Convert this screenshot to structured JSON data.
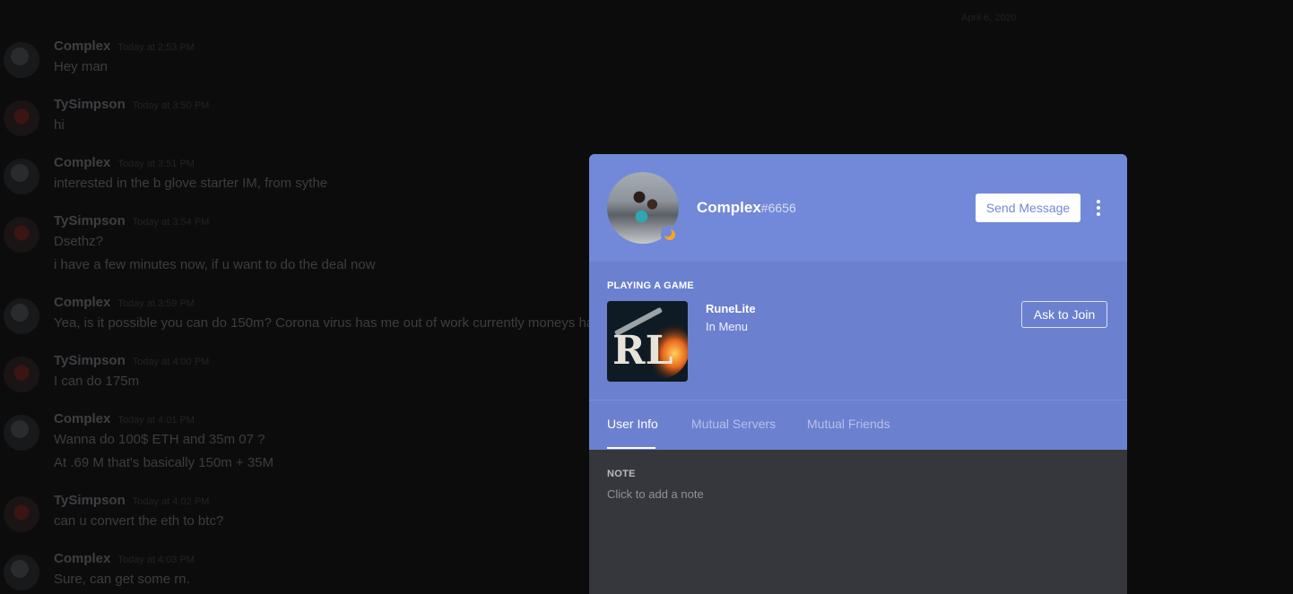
{
  "chat": {
    "date_divider": "April 6, 2020",
    "messages": [
      {
        "author": "Complex",
        "timestamp": "Today at 2:53 PM",
        "lines": [
          "Hey man"
        ]
      },
      {
        "author": "TySimpson",
        "timestamp": "Today at 3:50 PM",
        "lines": [
          "hi"
        ]
      },
      {
        "author": "Complex",
        "timestamp": "Today at 3:51 PM",
        "lines": [
          "interested in the b glove starter IM, from sythe"
        ]
      },
      {
        "author": "TySimpson",
        "timestamp": "Today at 3:54 PM",
        "lines": [
          "Dsethz?",
          "i have a few minutes now, if u want to do the deal now"
        ]
      },
      {
        "author": "Complex",
        "timestamp": "Today at 3:59 PM",
        "lines": [
          "Yea, is it possible you can do 150m? Corona virus has me out of work currently moneys ha"
        ]
      },
      {
        "author": "TySimpson",
        "timestamp": "Today at 4:00 PM",
        "lines": [
          "I can do 175m"
        ]
      },
      {
        "author": "Complex",
        "timestamp": "Today at 4:01 PM",
        "lines": [
          "Wanna do 100$ ETH and 35m 07 ?",
          "At .69 M that's basically 150m + 35M"
        ]
      },
      {
        "author": "TySimpson",
        "timestamp": "Today at 4:02 PM",
        "lines": [
          "can u convert the eth to btc?"
        ]
      },
      {
        "author": "Complex",
        "timestamp": "Today at 4:03 PM",
        "lines": [
          "Sure, can get some rn."
        ]
      }
    ]
  },
  "profile": {
    "username": "Complex",
    "discriminator": "#6656",
    "status": "idle",
    "send_message_label": "Send Message",
    "activity": {
      "heading": "PLAYING A GAME",
      "game_name": "RuneLite",
      "game_state": "In Menu",
      "game_logo_text": "RL",
      "ask_to_join_label": "Ask to Join"
    },
    "tabs": [
      {
        "label": "User Info",
        "active": true
      },
      {
        "label": "Mutual Servers",
        "active": false
      },
      {
        "label": "Mutual Friends",
        "active": false
      }
    ],
    "note": {
      "heading": "NOTE",
      "placeholder": "Click to add a note"
    }
  },
  "colors": {
    "blurple": "#7289da",
    "activity_bg": "#6b80cf",
    "body_bg": "#36373c",
    "backdrop": "#0c0c0d"
  }
}
